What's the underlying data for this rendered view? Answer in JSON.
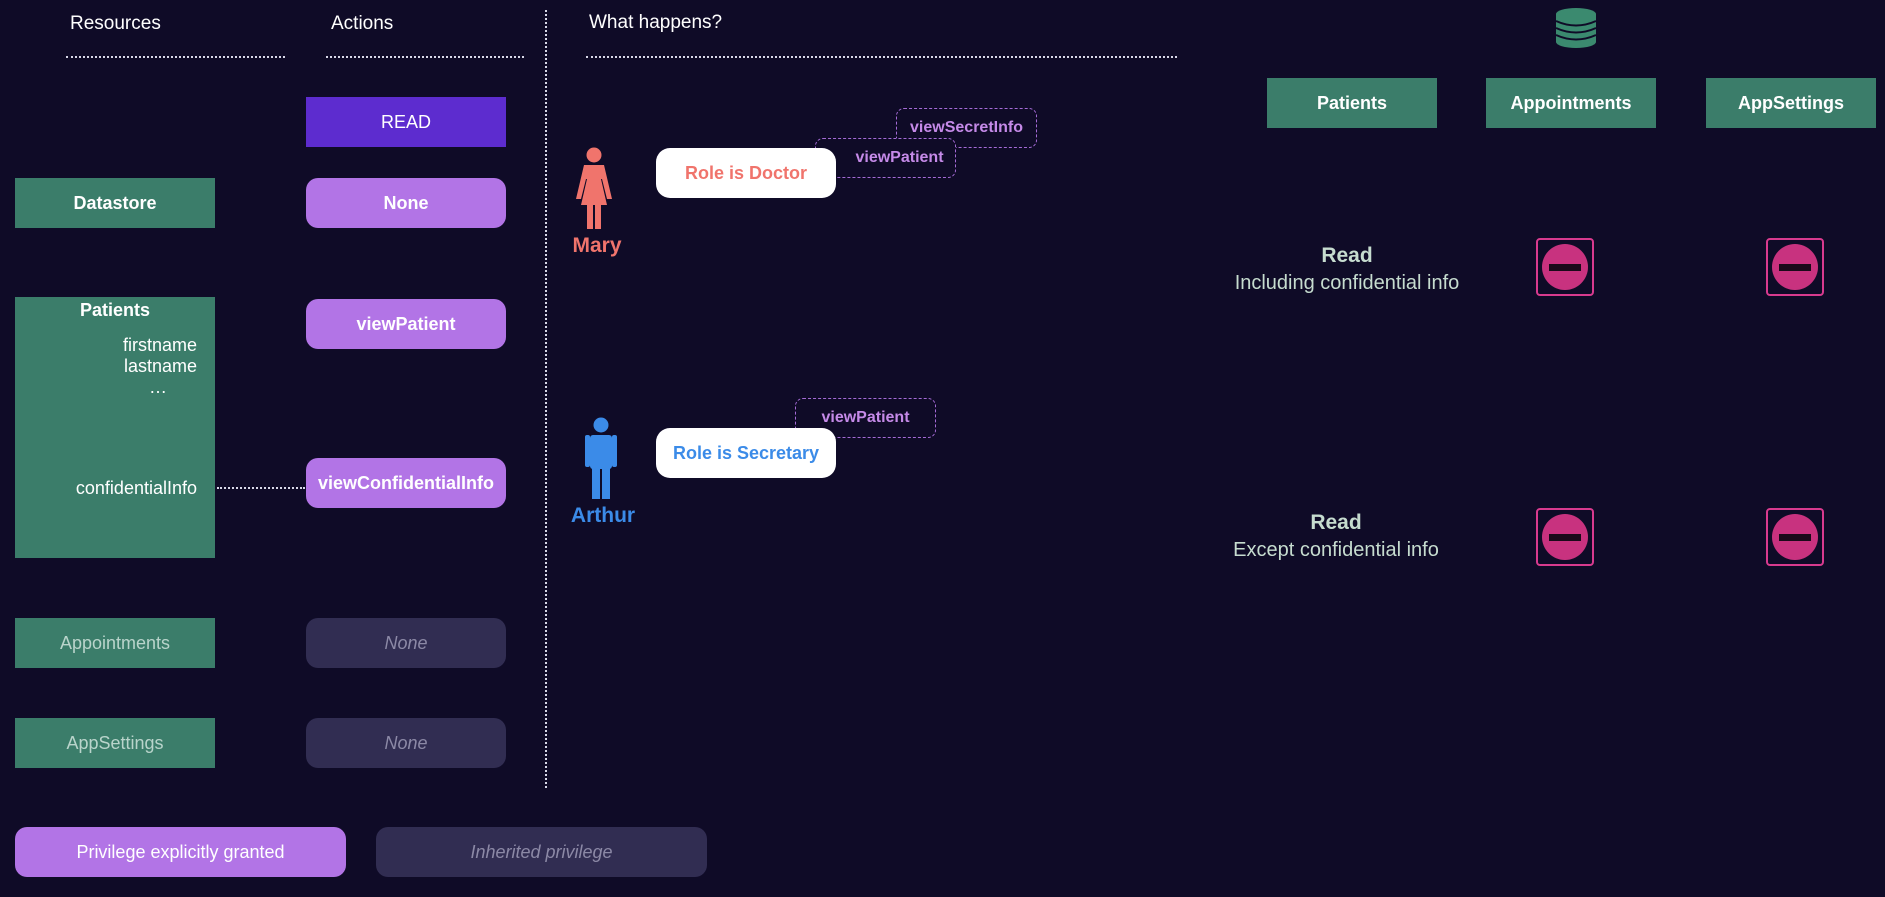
{
  "headers": {
    "resources": "Resources",
    "actions": "Actions",
    "what_happens": "What happens?"
  },
  "resources": {
    "datastore": "Datastore",
    "patients": "Patients",
    "fields": [
      "firstname",
      "lastname",
      "…"
    ],
    "confidential": "confidentialInfo",
    "appointments": "Appointments",
    "appsettings": "AppSettings"
  },
  "actions": {
    "read": "READ",
    "datastore": "None",
    "view_patient": "viewPatient",
    "view_confidential": "viewConfidentialInfo",
    "appointments": "None",
    "appsettings": "None"
  },
  "legend": {
    "granted": "Privilege explicitly granted",
    "inherited": "Inherited privilege"
  },
  "users": [
    {
      "name": "Mary",
      "role": "Role is Doctor",
      "color": "#f0746c",
      "tags": [
        "viewSecretInfo",
        "viewPatient"
      ]
    },
    {
      "name": "Arthur",
      "role": "Role is Secretary",
      "color": "#3b8be8",
      "tags": [
        "viewPatient"
      ]
    }
  ],
  "columns": [
    "Patients",
    "Appointments",
    "AppSettings"
  ],
  "results": [
    {
      "title": "Read",
      "subtitle": "Including confidential info"
    },
    {
      "title": "Read",
      "subtitle": "Except confidential info"
    }
  ],
  "icons": {
    "database": "database-icon",
    "woman": "woman-icon",
    "man": "man-icon",
    "denied": "no-entry-icon"
  },
  "colors": {
    "granted": "#b274e6",
    "inherited": "#312d52",
    "resource": "#3b7d6a",
    "read_header": "#5d2ccf",
    "denied": "#c8327f"
  }
}
